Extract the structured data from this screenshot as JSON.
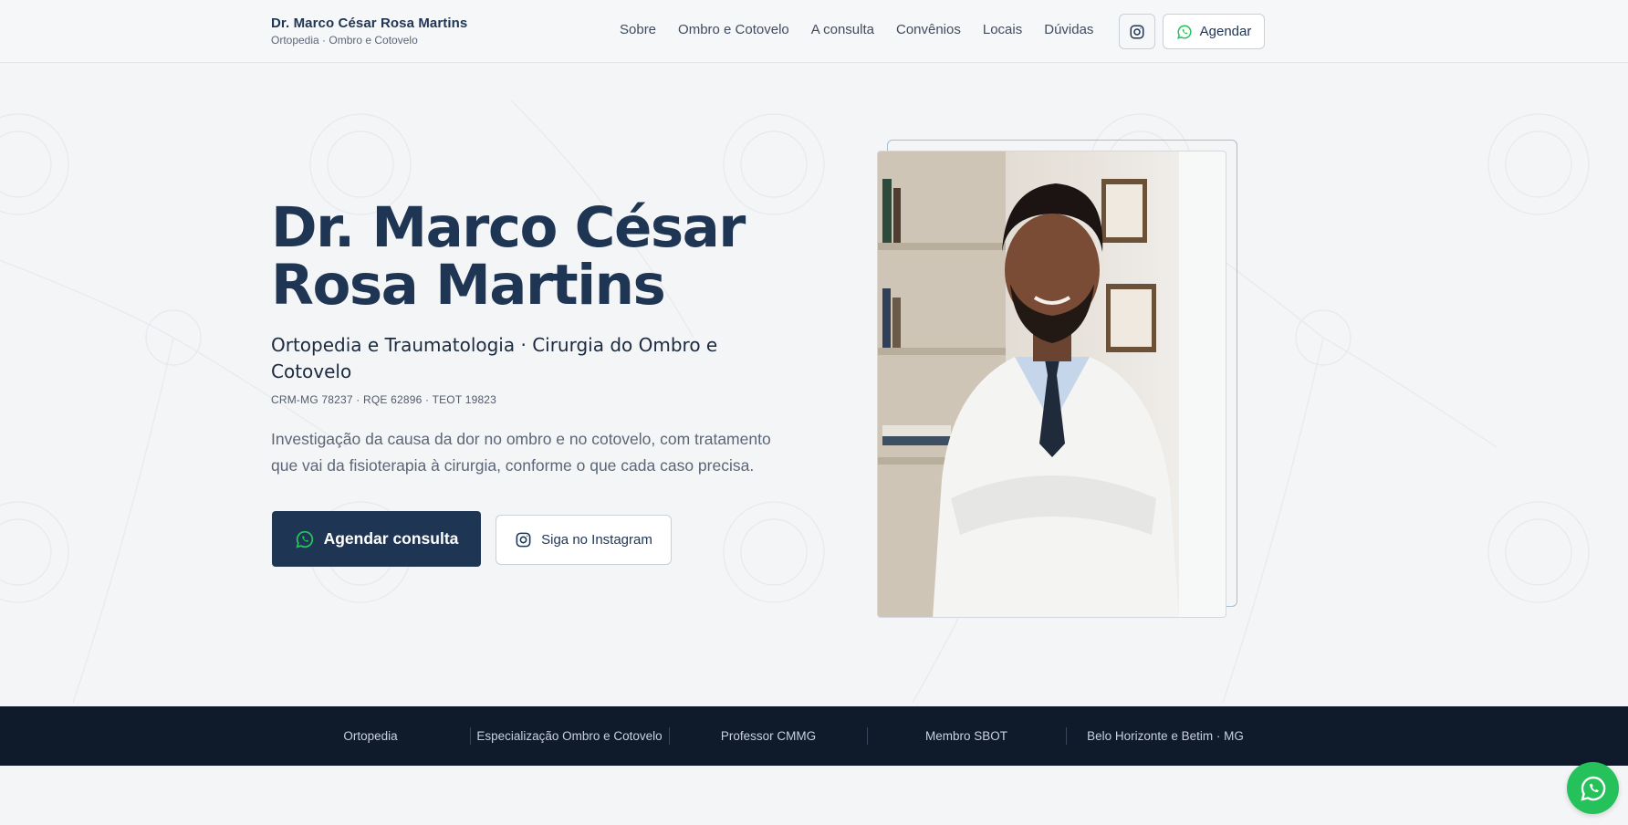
{
  "header": {
    "brand_name": "Dr. Marco César Rosa Martins",
    "brand_sub": "Ortopedia · Ombro e Cotovelo",
    "nav": [
      "Sobre",
      "Ombro e Cotovelo",
      "A consulta",
      "Convênios",
      "Locais",
      "Dúvidas"
    ],
    "agendar_label": "Agendar",
    "instagram_icon": "instagram-icon",
    "whatsapp_icon": "whatsapp-icon"
  },
  "hero": {
    "title_line1": "Dr. Marco César",
    "title_line2": "Rosa Martins",
    "specialty": "Ortopedia e Traumatologia · Cirurgia do Ombro e Cotovelo",
    "registration": "CRM-MG 78237 · RQE 62896 · TEOT 19823",
    "description": "Investigação da causa da dor no ombro e no cotovelo, com tratamento que vai da fisioterapia à cirurgia, conforme o que cada caso precisa.",
    "cta_primary": "Agendar consulta",
    "cta_secondary": "Siga no Instagram"
  },
  "strip": {
    "items": [
      "Ortopedia",
      "Especialização Ombro e Cotovelo",
      "Professor CMMG",
      "Membro SBOT",
      "Belo Horizonte e Betim · MG"
    ]
  },
  "colors": {
    "navy": "#1f3554",
    "dark_strip": "#0f1b2b",
    "whatsapp_green": "#25c15a",
    "background": "#f4f5f7"
  }
}
